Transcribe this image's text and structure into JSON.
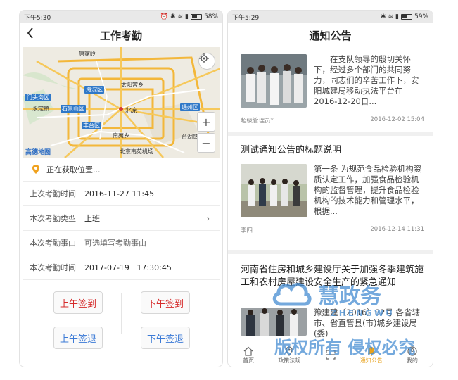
{
  "left": {
    "status_time": "下午5:30",
    "battery": "58%",
    "battery_level": 0.58,
    "title": "工作考勤",
    "back_icon": "chevron-left-icon",
    "map": {
      "places": [
        "唐家岭",
        "太阳宫乡",
        "海淀区",
        "门头沟区",
        "永定镇",
        "石景山区",
        "北京",
        "通州区",
        "丰台区",
        "南苑乡",
        "台湖镇",
        "北京南苑机场"
      ],
      "logo": "高德地图",
      "zoom_in": "+",
      "zoom_out": "−",
      "locate_icon": "crosshair-icon"
    },
    "location_text": "正在获取位置...",
    "fields": [
      {
        "label": "上次考勤时间",
        "value": "2016-11-27 11:45"
      },
      {
        "label": "本次考勤类型",
        "value": "上班"
      },
      {
        "label": "本次考勤事由",
        "value": "可选填写考勤事由"
      },
      {
        "label": "本次考勤时间",
        "value": "2017-07-19   17:30:45"
      }
    ],
    "buttons": {
      "am_in": "上午签到",
      "pm_in": "下午签到",
      "am_out": "上午签退",
      "pm_out": "下午签退"
    }
  },
  "right": {
    "status_time": "下午5:29",
    "battery": "59%",
    "battery_level": 0.59,
    "title": "通知公告",
    "notices": [
      {
        "summary": "在支队领导的殷切关怀下，经过多个部门的共同努力，同志们的辛苦工作下，安阳城建局移动执法平台在2016-12-20日...",
        "author": "超级管理员*",
        "date": "2016-12-02 15:04"
      },
      {
        "title": "测试通知公告的标题说明",
        "summary": "第一条 为规范食品检验机构资质认定工作，加强食品检验机构的监督管理，提升食品检验机构的技术能力和管理水平，根据...",
        "author": "李四",
        "date": "2016-12-14 11:31"
      },
      {
        "title": "河南省住房和城乡建设厅关于加强冬季建筑施工和农村房屋建设安全生产的紧急通知",
        "summary": "豫建建〔2016〕82号 各省辖市、省直管县(市)城乡建设局(委)"
      }
    ],
    "tabs": [
      {
        "label": "首页",
        "icon": "home-icon"
      },
      {
        "label": "政策法规",
        "icon": "pin-icon"
      },
      {
        "label": "",
        "icon": "scan-icon"
      },
      {
        "label": "通知公告",
        "icon": "bell-icon"
      },
      {
        "label": "我的",
        "icon": "user-icon"
      }
    ]
  },
  "watermark": {
    "line1": "慧政务",
    "line2": "ZHENGWU",
    "line3": "版权所有 侵权必究"
  }
}
